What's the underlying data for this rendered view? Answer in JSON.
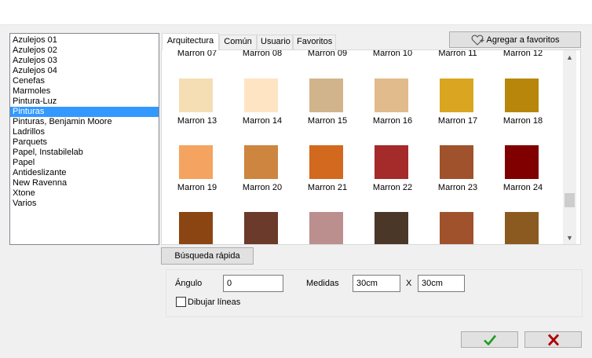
{
  "categories": [
    "Azulejos 01",
    "Azulejos 02",
    "Azulejos 03",
    "Azulejos 04",
    "Cenefas",
    "Marmoles",
    "Pintura-Luz",
    "Pinturas",
    "Pinturas, Benjamin Moore",
    "Ladrillos",
    "Parquets",
    "Papel, Instabilelab",
    "Papel",
    "Antideslizante",
    "New Ravenna",
    "Xtone",
    "Varios"
  ],
  "selected_category": "Pinturas",
  "tabs": [
    {
      "label": "Arquitectura",
      "active": true
    },
    {
      "label": "Común",
      "active": false
    },
    {
      "label": "Usuario",
      "active": false
    },
    {
      "label": "Favoritos",
      "active": false
    }
  ],
  "favorite_button": {
    "label": "Agregar a favoritos",
    "icon": "heart-plus-icon"
  },
  "swatch_rows": [
    {
      "partial_top": true,
      "items": [
        {
          "label": "Marron 07"
        },
        {
          "label": "Marron 08"
        },
        {
          "label": "Marron 09"
        },
        {
          "label": "Marron 10"
        },
        {
          "label": "Marron 11"
        },
        {
          "label": "Marron 12"
        }
      ]
    },
    {
      "items": [
        {
          "label": "Marron 13",
          "color": "#F5DEB3"
        },
        {
          "label": "Marron 14",
          "color": "#FFE4C4"
        },
        {
          "label": "Marron 15",
          "color": "#D2B48C"
        },
        {
          "label": "Marron 16",
          "color": "#E1BB8C"
        },
        {
          "label": "Marron 17",
          "color": "#DAA520"
        },
        {
          "label": "Marron 18",
          "color": "#B8860B"
        }
      ]
    },
    {
      "items": [
        {
          "label": "Marron 19",
          "color": "#F4A460"
        },
        {
          "label": "Marron 20",
          "color": "#CD853F"
        },
        {
          "label": "Marron 21",
          "color": "#D2691E"
        },
        {
          "label": "Marron 22",
          "color": "#A52A2A"
        },
        {
          "label": "Marron 23",
          "color": "#A0522D"
        },
        {
          "label": "Marron 24",
          "color": "#800000"
        }
      ]
    },
    {
      "partial_bottom": true,
      "items": [
        {
          "color": "#8B4513"
        },
        {
          "color": "#6B3A2A"
        },
        {
          "color": "#BC8F8F"
        },
        {
          "color": "#4A3728"
        },
        {
          "color": "#A0522D"
        },
        {
          "color": "#8B5A20"
        }
      ]
    }
  ],
  "quick_search_label": "Búsqueda rápida",
  "angle": {
    "label": "Ángulo",
    "value": "0"
  },
  "measures": {
    "label": "Medidas",
    "width": "30cm",
    "separator": "X",
    "height": "30cm"
  },
  "draw_lines": {
    "label": "Dibujar líneas",
    "checked": false
  },
  "ok_icon": "check-icon",
  "ok_color": "#1f9d1f",
  "cancel_icon": "close-icon",
  "cancel_color": "#b00000",
  "selection_color": "#3399ff"
}
